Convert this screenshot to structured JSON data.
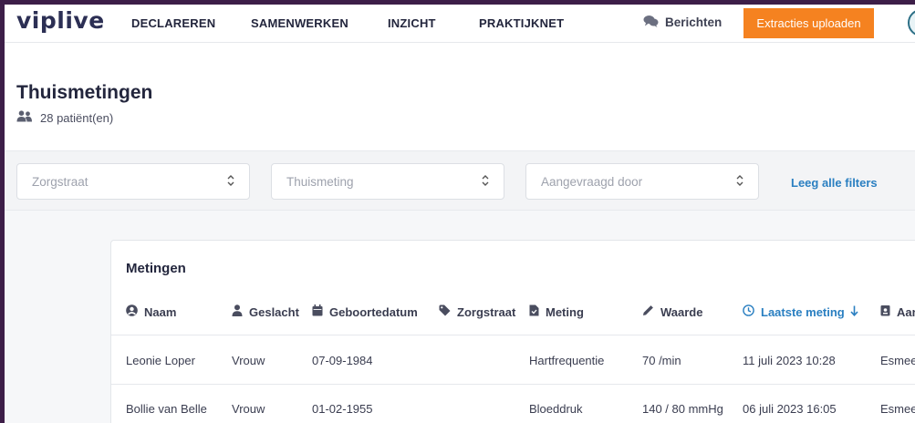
{
  "nav": {
    "logo": "viplive",
    "links": [
      "DECLAREREN",
      "SAMENWERKEN",
      "INZICHT",
      "PRAKTIJKNET"
    ],
    "messages": "Berichten",
    "upload_button": "Extracties uploaden"
  },
  "header": {
    "title": "Thuismetingen",
    "patient_count": "28 patiënt(en)"
  },
  "filters": {
    "zorgstraat_placeholder": "Zorgstraat",
    "thuismeting_placeholder": "Thuismeting",
    "aangevraagd_placeholder": "Aangevraagd door",
    "clear_all": "Leeg alle filters"
  },
  "table": {
    "title": "Metingen",
    "columns": [
      "Naam",
      "Geslacht",
      "Geboortedatum",
      "Zorgstraat",
      "Meting",
      "Waarde",
      "Laatste meting",
      "Aan"
    ],
    "rows": [
      {
        "naam": "Leonie Loper",
        "geslacht": "Vrouw",
        "geboortedatum": "07-09-1984",
        "zorgstraat": "",
        "meting": "Hartfrequentie",
        "waarde": "70 /min",
        "laatste": "11 juli 2023 10:28",
        "aan": "Esmee"
      },
      {
        "naam": "Bollie van Belle",
        "geslacht": "Vrouw",
        "geboortedatum": "01-02-1955",
        "zorgstraat": "",
        "meting": "Bloeddruk",
        "waarde": "140 / 80 mmHg",
        "laatste": "06 juli 2023 16:05",
        "aan": "Esmee"
      }
    ]
  },
  "colors": {
    "accent_orange": "#f58220",
    "link_blue": "#2a7fc1",
    "frame_purple": "#3d1e48"
  }
}
